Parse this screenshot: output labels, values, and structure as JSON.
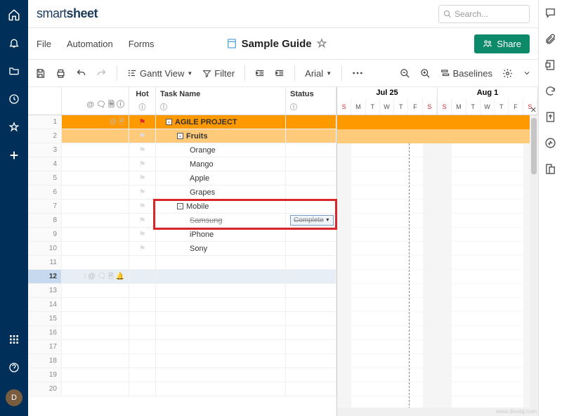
{
  "brand": {
    "part1": "smart",
    "part2": "sheet"
  },
  "search": {
    "placeholder": "Search..."
  },
  "menu": {
    "file": "File",
    "automation": "Automation",
    "forms": "Forms"
  },
  "doc": {
    "title": "Sample Guide"
  },
  "share_label": "Share",
  "toolbar": {
    "gantt": "Gantt View",
    "filter": "Filter",
    "font": "Arial",
    "baselines": "Baselines"
  },
  "columns": {
    "hot": "Hot",
    "task": "Task Name",
    "status": "Status"
  },
  "timeline": {
    "weeks": [
      {
        "label": "Jul 25",
        "days": [
          "S",
          "M",
          "T",
          "W",
          "T",
          "F",
          "S"
        ]
      },
      {
        "label": "Aug 1",
        "days": [
          "S",
          "M",
          "T",
          "W",
          "T",
          "F",
          "S"
        ]
      }
    ]
  },
  "rows": [
    {
      "n": "1",
      "icons": "@ 🗎",
      "flag": "red",
      "collapse": "-",
      "task": "AGILE PROJECT",
      "indent": 0,
      "style": "orange"
    },
    {
      "n": "2",
      "icons": "",
      "flag": "white",
      "collapse": "-",
      "task": "Fruits",
      "indent": 1,
      "style": "lightorange"
    },
    {
      "n": "3",
      "icons": "",
      "flag": "flagwhite",
      "task": "Orange",
      "indent": 2
    },
    {
      "n": "4",
      "icons": "",
      "flag": "flagwhite",
      "task": "Mango",
      "indent": 2
    },
    {
      "n": "5",
      "icons": "",
      "flag": "flagwhite",
      "task": "Apple",
      "indent": 2
    },
    {
      "n": "6",
      "icons": "",
      "flag": "flagwhite",
      "task": "Grapes",
      "indent": 2
    },
    {
      "n": "7",
      "icons": "",
      "flag": "flagwhite",
      "collapse": "-",
      "task": "Mobile",
      "indent": 1
    },
    {
      "n": "8",
      "icons": "",
      "flag": "flagwhite",
      "task": "Samsung",
      "indent": 2,
      "strike": true,
      "status": "Complete"
    },
    {
      "n": "9",
      "icons": "",
      "flag": "flagwhite",
      "task": "iPhone",
      "indent": 2
    },
    {
      "n": "10",
      "icons": "",
      "flag": "flagwhite",
      "task": "Sony",
      "indent": 2
    },
    {
      "n": "11"
    },
    {
      "n": "12",
      "icons": "⁝ @ 🗨 🗎 🔔",
      "selected": true
    },
    {
      "n": "13"
    },
    {
      "n": "14"
    },
    {
      "n": "15"
    },
    {
      "n": "16"
    },
    {
      "n": "17"
    },
    {
      "n": "18"
    },
    {
      "n": "19"
    },
    {
      "n": "20"
    }
  ],
  "avatar": "D",
  "watermark": "www.devaq.com"
}
